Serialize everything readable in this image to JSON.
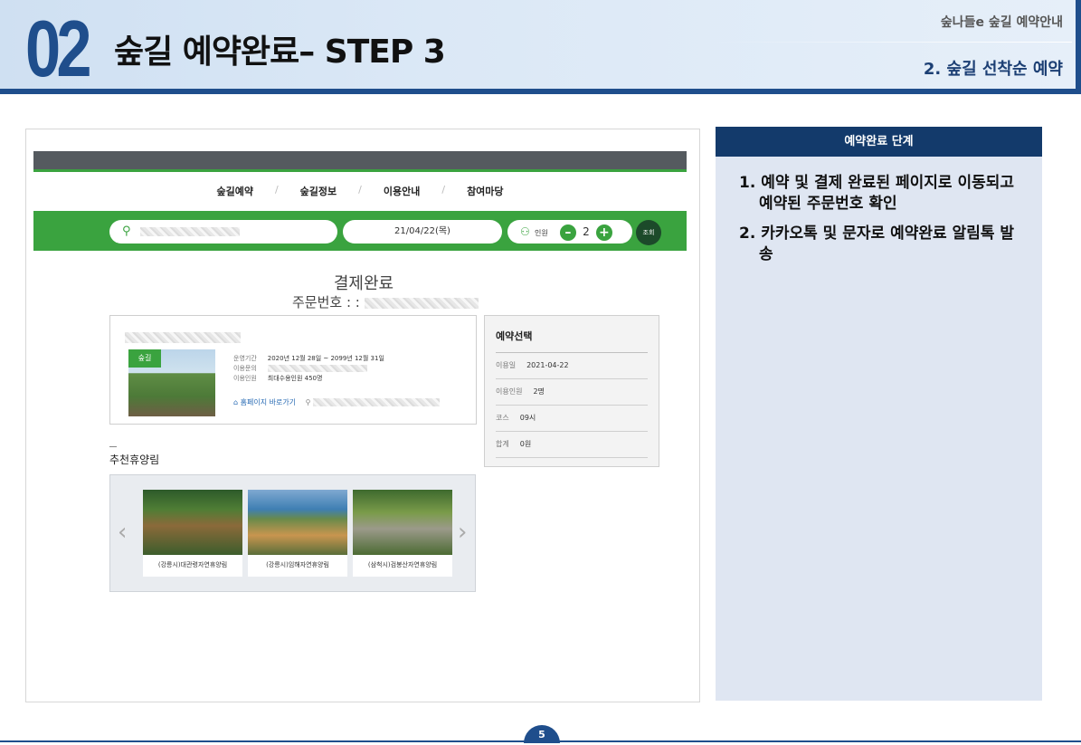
{
  "header": {
    "number": "02",
    "title": "숲길 예약완료– STEP 3",
    "sub1": "숲나들e 숲길 예약안내",
    "sub2": "2. 숲길 선착순 예약"
  },
  "screen": {
    "nav": [
      "숲길예약",
      "숲길정보",
      "이용안내",
      "참여마당"
    ],
    "nav_sep": "/",
    "search": {
      "date": "21/04/22(목)",
      "people_label": "인원",
      "people_count": "2",
      "search_button": "조회"
    },
    "complete_title": "결제완료",
    "order_label": "주문번호 : :",
    "info": {
      "tag": "숲길",
      "rows": [
        {
          "label": "운영기간",
          "value": "2020년 12월 28일 ~ 2099년 12월 31일"
        },
        {
          "label": "이용문의",
          "value": ""
        },
        {
          "label": "이용인원",
          "value": "최대수용인원 450명"
        }
      ],
      "home_link": "홈페이지 바로가기"
    },
    "selection": {
      "title": "예약선택",
      "rows": [
        {
          "label": "이용일",
          "value": "2021-04-22"
        },
        {
          "label": "이용인원",
          "value": "2명"
        },
        {
          "label": "코스",
          "value": "09시"
        },
        {
          "label": "합계",
          "value": "0원"
        }
      ]
    },
    "recommend_title": "추천휴양림",
    "recommend": [
      {
        "name": "(강릉시)대관령자연휴양림"
      },
      {
        "name": "(강릉시)임해자연휴양림"
      },
      {
        "name": "(삼척시)검봉산자연휴양림"
      }
    ]
  },
  "panel": {
    "title": "예약완료 단계",
    "items": [
      "1. 예약 및 결제 완료된 페이지로 이동되고 예약된 주문번호 확인",
      "2. 카카오톡 및 문자로 예약완료 알림톡 발송"
    ]
  },
  "page_number": "5"
}
